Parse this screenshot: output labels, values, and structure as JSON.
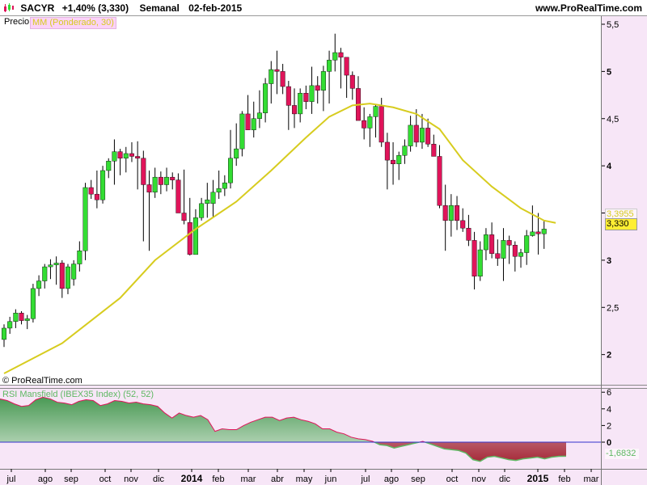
{
  "header": {
    "ticker": "SACYR",
    "change": "+1,40% (3,330)",
    "period": "Semanal",
    "date": "02-feb-2015",
    "site": "www.ProRealTime.com"
  },
  "panel_tags": {
    "price": "Precio",
    "ma": "MM (Ponderado, 30)",
    "copyright": "© ProRealTime.com",
    "rsi": "RSI Mansfield (IBEX35 Index) (52, 52)"
  },
  "price_labels": {
    "ma_value": "3,3955",
    "last_value": "3,330"
  },
  "rsi_labels": {
    "last_value": "-1,6832"
  },
  "colors": {
    "up": "#33dd33",
    "down": "#e0145a",
    "ma": "#d7cc1f",
    "background": "#f7e6f7",
    "rsi_positive_fill": "#4a9a55",
    "rsi_negative_fill": "#a62b3a",
    "zero_line": "#3333cc"
  },
  "chart_data": [
    {
      "type": "candlestick",
      "title": "",
      "ylim": [
        1.75,
        5.6
      ],
      "y_ticks": [
        "2",
        "2,5",
        "3",
        "3,5",
        "4",
        "4,5",
        "5",
        "5,5"
      ],
      "x_labels": [
        "jul",
        "ago",
        "sep",
        "oct",
        "nov",
        "dic",
        "2014",
        "feb",
        "mar",
        "abr",
        "may",
        "jun",
        "jul",
        "ago",
        "sep",
        "oct",
        "nov",
        "dic",
        "2015",
        "feb",
        "mar"
      ],
      "ohlc": [
        [
          2.16,
          2.32,
          2.08,
          2.28
        ],
        [
          2.28,
          2.4,
          2.22,
          2.35
        ],
        [
          2.35,
          2.48,
          2.28,
          2.44
        ],
        [
          2.44,
          2.46,
          2.32,
          2.36
        ],
        [
          2.36,
          2.42,
          2.27,
          2.38
        ],
        [
          2.38,
          2.75,
          2.34,
          2.7
        ],
        [
          2.7,
          2.84,
          2.62,
          2.78
        ],
        [
          2.78,
          2.96,
          2.7,
          2.93
        ],
        [
          2.93,
          3.01,
          2.8,
          2.95
        ],
        [
          2.95,
          3.04,
          2.74,
          2.97
        ],
        [
          2.97,
          3.0,
          2.6,
          2.7
        ],
        [
          2.7,
          2.96,
          2.64,
          2.93
        ],
        [
          2.8,
          3.0,
          2.73,
          2.96
        ],
        [
          2.96,
          3.2,
          2.88,
          3.1
        ],
        [
          3.1,
          3.82,
          3.0,
          3.77
        ],
        [
          3.77,
          3.85,
          3.65,
          3.7
        ],
        [
          3.7,
          3.95,
          3.55,
          3.64
        ],
        [
          3.64,
          4.0,
          3.6,
          3.95
        ],
        [
          3.95,
          4.08,
          3.87,
          4.05
        ],
        [
          4.05,
          4.28,
          3.8,
          4.15
        ],
        [
          4.15,
          4.18,
          3.9,
          4.08
        ],
        [
          4.08,
          4.2,
          3.93,
          4.13
        ],
        [
          4.13,
          4.25,
          4.04,
          4.1
        ],
        [
          4.1,
          4.26,
          3.75,
          4.08
        ],
        [
          4.08,
          4.16,
          3.2,
          3.8
        ],
        [
          3.8,
          3.95,
          3.1,
          3.72
        ],
        [
          3.72,
          3.98,
          3.66,
          3.88
        ],
        [
          3.88,
          3.94,
          3.7,
          3.8
        ],
        [
          3.8,
          3.98,
          3.73,
          3.88
        ],
        [
          3.88,
          3.93,
          3.75,
          3.85
        ],
        [
          3.85,
          3.92,
          3.6,
          3.5
        ],
        [
          3.5,
          3.96,
          3.38,
          3.42
        ],
        [
          3.4,
          3.66,
          3.05,
          3.06
        ],
        [
          3.06,
          3.54,
          3.07,
          3.45
        ],
        [
          3.45,
          3.66,
          3.42,
          3.6
        ],
        [
          3.6,
          3.82,
          3.45,
          3.64
        ],
        [
          3.6,
          3.85,
          3.45,
          3.72
        ],
        [
          3.72,
          3.95,
          3.65,
          3.76
        ],
        [
          3.76,
          3.9,
          3.68,
          3.82
        ],
        [
          3.82,
          4.38,
          3.76,
          4.08
        ],
        [
          4.08,
          4.45,
          4.0,
          4.18
        ],
        [
          4.18,
          4.58,
          4.1,
          4.55
        ],
        [
          4.55,
          4.75,
          4.4,
          4.38
        ],
        [
          4.38,
          4.68,
          4.3,
          4.5
        ],
        [
          4.5,
          4.8,
          4.4,
          4.56
        ],
        [
          4.56,
          4.93,
          4.46,
          4.87
        ],
        [
          4.87,
          5.11,
          4.66,
          5.02
        ],
        [
          5.02,
          5.22,
          4.76,
          5.0
        ],
        [
          5.0,
          5.08,
          4.76,
          4.84
        ],
        [
          4.84,
          4.9,
          4.38,
          4.64
        ],
        [
          4.64,
          4.82,
          4.4,
          4.55
        ],
        [
          4.55,
          4.82,
          4.46,
          4.77
        ],
        [
          4.77,
          4.85,
          4.6,
          4.68
        ],
        [
          4.68,
          5.05,
          4.55,
          4.85
        ],
        [
          4.85,
          4.95,
          4.66,
          4.8
        ],
        [
          4.8,
          5.06,
          4.58,
          5.0
        ],
        [
          5.0,
          5.22,
          4.66,
          5.12
        ],
        [
          5.12,
          5.4,
          5.0,
          5.2
        ],
        [
          5.2,
          5.25,
          4.82,
          5.15
        ],
        [
          5.15,
          5.08,
          4.72,
          4.96
        ],
        [
          4.96,
          5.0,
          4.7,
          4.82
        ],
        [
          4.82,
          4.95,
          4.52,
          4.48
        ],
        [
          4.48,
          4.62,
          4.28,
          4.4
        ],
        [
          4.4,
          4.55,
          4.2,
          4.52
        ],
        [
          4.52,
          4.65,
          4.3,
          4.63
        ],
        [
          4.63,
          4.72,
          4.2,
          4.25
        ],
        [
          4.25,
          4.35,
          3.75,
          4.06
        ],
        [
          4.06,
          4.25,
          3.8,
          4.02
        ],
        [
          4.02,
          4.15,
          3.85,
          4.11
        ],
        [
          4.11,
          4.28,
          4.02,
          4.21
        ],
        [
          4.21,
          4.53,
          4.15,
          4.43
        ],
        [
          4.43,
          4.6,
          4.2,
          4.25
        ],
        [
          4.25,
          4.55,
          4.18,
          4.4
        ],
        [
          4.4,
          4.5,
          4.2,
          4.23
        ],
        [
          4.23,
          4.33,
          4.12,
          4.1
        ],
        [
          4.1,
          4.22,
          3.55,
          3.58
        ],
        [
          3.58,
          3.8,
          3.1,
          3.42
        ],
        [
          3.42,
          3.7,
          3.25,
          3.58
        ],
        [
          3.58,
          3.68,
          3.32,
          3.42
        ],
        [
          3.42,
          3.55,
          3.3,
          3.34
        ],
        [
          3.34,
          3.48,
          3.15,
          3.21
        ],
        [
          3.21,
          3.3,
          2.69,
          2.83
        ],
        [
          2.83,
          3.2,
          2.78,
          3.11
        ],
        [
          3.11,
          3.34,
          3.0,
          3.27
        ],
        [
          3.27,
          3.4,
          3.02,
          3.07
        ],
        [
          3.07,
          3.22,
          2.94,
          3.02
        ],
        [
          3.02,
          3.34,
          2.78,
          3.21
        ],
        [
          3.21,
          3.26,
          2.96,
          3.16
        ],
        [
          3.16,
          3.2,
          2.88,
          3.04
        ],
        [
          3.04,
          3.12,
          2.92,
          3.08
        ],
        [
          3.08,
          3.32,
          2.95,
          3.26
        ],
        [
          3.26,
          3.58,
          3.25,
          3.3
        ],
        [
          3.3,
          3.5,
          3.06,
          3.28
        ],
        [
          3.28,
          3.42,
          3.12,
          3.33
        ]
      ],
      "ma": [
        [
          0,
          1.8
        ],
        [
          10,
          2.12
        ],
        [
          20,
          2.6
        ],
        [
          26,
          3.0
        ],
        [
          33,
          3.33
        ],
        [
          40,
          3.62
        ],
        [
          46,
          3.95
        ],
        [
          52,
          4.3
        ],
        [
          56,
          4.52
        ],
        [
          60,
          4.64
        ],
        [
          63,
          4.66
        ],
        [
          67,
          4.62
        ],
        [
          71,
          4.55
        ],
        [
          75,
          4.39
        ],
        [
          79,
          4.06
        ],
        [
          84,
          3.78
        ],
        [
          89,
          3.55
        ],
        [
          93,
          3.42
        ],
        [
          95,
          3.3955
        ]
      ]
    },
    {
      "type": "area",
      "title": "",
      "ylim": [
        -2.8,
        6.8
      ],
      "y_ticks": [
        "6",
        "4",
        "2",
        "0"
      ],
      "values": [
        5.2,
        5.0,
        4.6,
        4.3,
        4.4,
        5.1,
        5.4,
        5.2,
        4.8,
        4.7,
        4.5,
        4.9,
        5.1,
        5.0,
        4.4,
        4.6,
        5.0,
        4.9,
        4.7,
        4.8,
        4.6,
        4.5,
        4.3,
        3.5,
        2.9,
        3.5,
        3.2,
        3.0,
        3.2,
        2.7,
        1.3,
        1.6,
        1.5,
        1.5,
        2.0,
        2.4,
        2.7,
        3.0,
        3.0,
        2.6,
        2.9,
        3.0,
        2.7,
        2.5,
        2.2,
        1.6,
        1.6,
        1.2,
        1.0,
        0.6,
        0.4,
        0.3,
        0.1,
        -0.3,
        -0.4,
        -0.7,
        -0.5,
        -0.3,
        -0.1,
        0.1,
        -0.2,
        -0.5,
        -0.8,
        -0.9,
        -1.0,
        -1.3,
        -2.1,
        -2.3,
        -1.8,
        -1.7,
        -1.9,
        -2.1,
        -2.2,
        -2.0,
        -1.9,
        -1.8,
        -2.0,
        -1.8,
        -1.7,
        -1.683
      ]
    }
  ]
}
